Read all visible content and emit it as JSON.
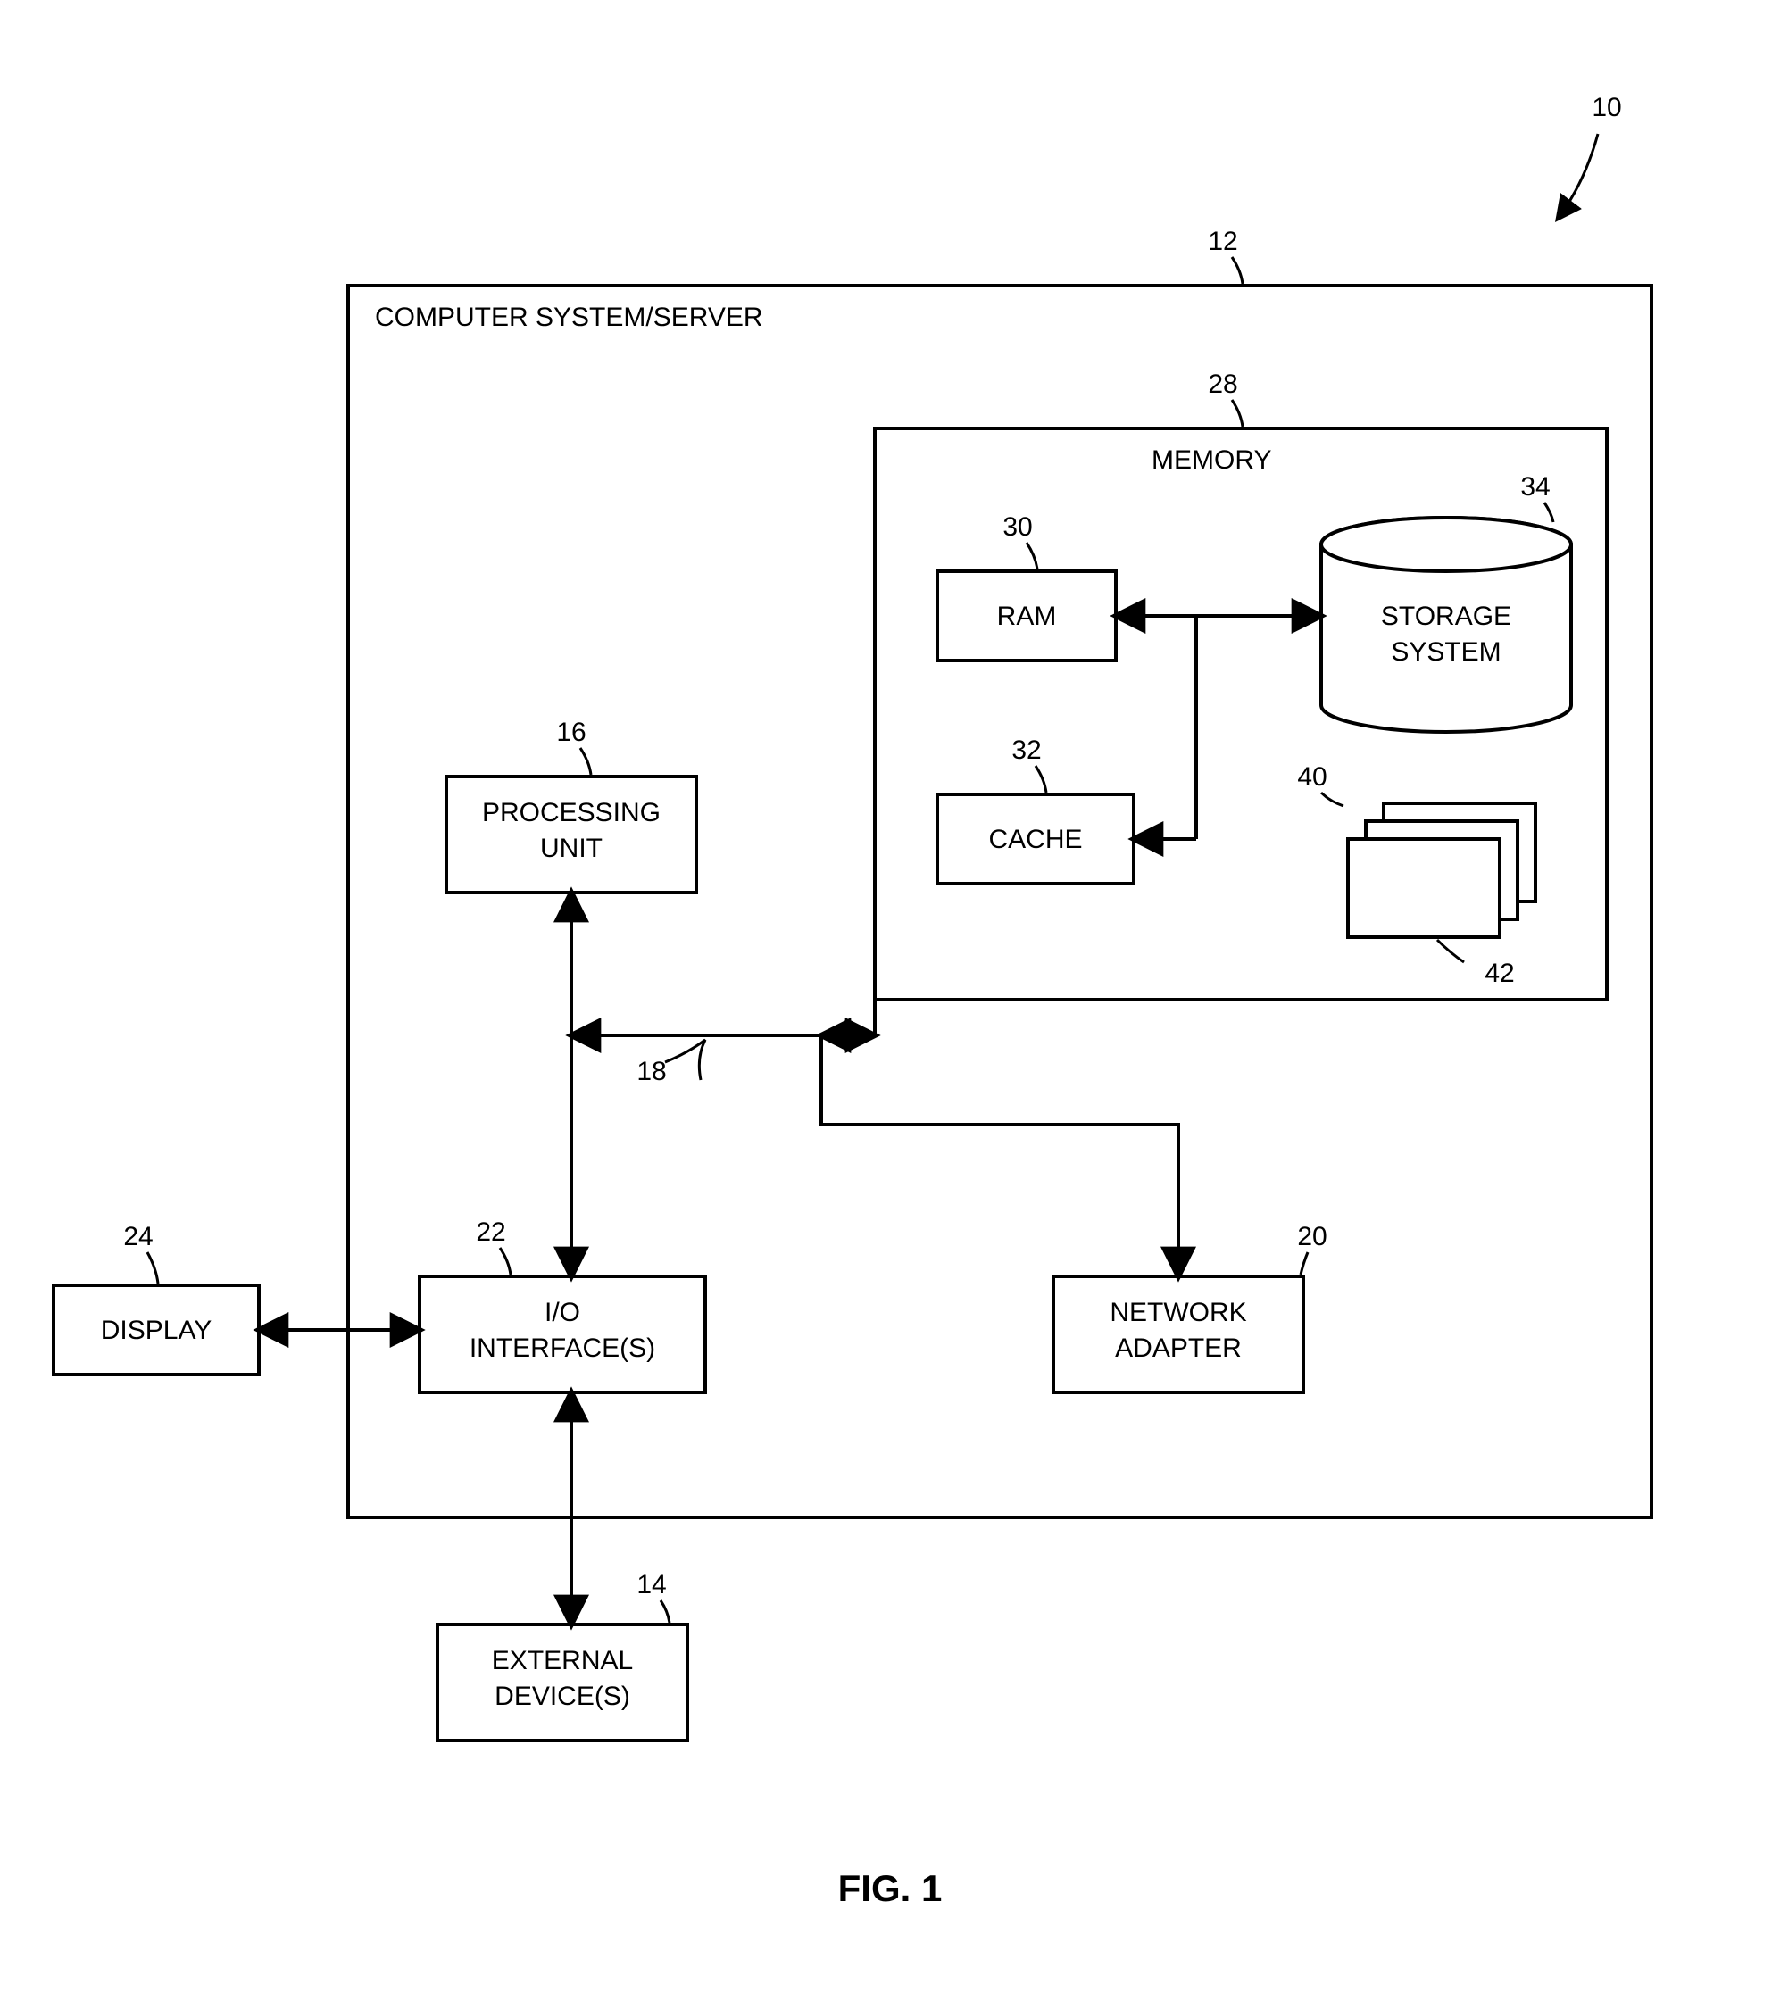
{
  "figure": {
    "caption": "FIG. 1",
    "ref_overall": "10",
    "system_title": "COMPUTER SYSTEM/SERVER",
    "system_ref": "12",
    "memory_title": "MEMORY",
    "memory_ref": "28",
    "processing": {
      "label_l1": "PROCESSING",
      "label_l2": "UNIT",
      "ref": "16"
    },
    "ram": {
      "label": "RAM",
      "ref": "30"
    },
    "cache": {
      "label": "CACHE",
      "ref": "32"
    },
    "storage": {
      "label_l1": "STORAGE",
      "label_l2": "SYSTEM",
      "ref": "34"
    },
    "modules": {
      "ref_group": "40",
      "ref_item": "42"
    },
    "io": {
      "label_l1": "I/O",
      "label_l2": "INTERFACE(S)",
      "ref": "22"
    },
    "display": {
      "label": "DISPLAY",
      "ref": "24"
    },
    "network": {
      "label_l1": "NETWORK",
      "label_l2": "ADAPTER",
      "ref": "20"
    },
    "external": {
      "label_l1": "EXTERNAL",
      "label_l2": "DEVICE(S)",
      "ref": "14"
    },
    "bus_ref": "18"
  }
}
